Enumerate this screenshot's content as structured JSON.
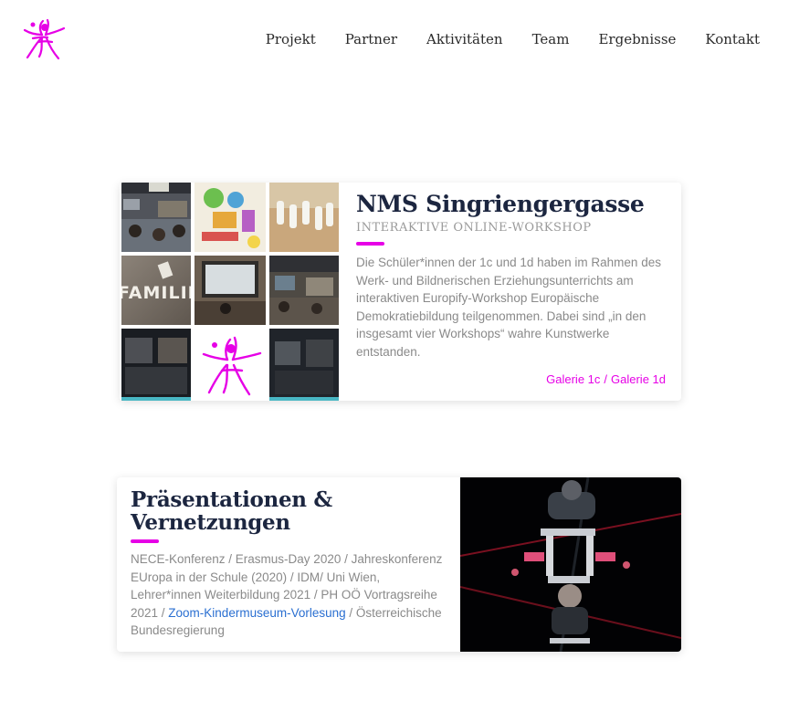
{
  "nav": {
    "items": [
      {
        "label": "Projekt"
      },
      {
        "label": "Partner"
      },
      {
        "label": "Aktivitäten"
      },
      {
        "label": "Team"
      },
      {
        "label": "Ergebnisse"
      },
      {
        "label": "Kontakt"
      }
    ]
  },
  "card1": {
    "title": "NMS Singriengergasse",
    "subtitle": "INTERAKTIVE ONLINE-WORKSHOP",
    "body": "Die Schüler*innen der 1c und 1d haben im Rahmen des Werk- und Bildnerischen Erziehungsunterrichts am interaktiven Europify-Workshop Europäische Demokratiebildung teilgenommen. Dabei sind „in den insgesamt vier Workshops“ wahre Kunstwerke entstanden.",
    "collage_tile_label": "FAMILIE",
    "gallery_links": [
      {
        "label": "Galerie 1c"
      },
      {
        "label": "Galerie 1d"
      }
    ],
    "gallery_separator": "/"
  },
  "card2": {
    "title": "Präsentationen & Vernetzungen",
    "body_before_link": "NECE-Konferenz / Erasmus-Day 2020 / Jahreskonferenz EUropa in der Schule (2020) / IDM/ Uni Wien, Lehrer*innen Weiterbildung 2021 / PH OÖ Vortragsreihe 2021 / ",
    "link": "Zoom-Kindermuseum-Vorlesung",
    "body_after_link": " / Österreichische Bundesregierung"
  },
  "colors": {
    "accent": "#e600e6",
    "title": "#1c2640",
    "body": "#8a8a8a",
    "link": "#2a6fd1"
  },
  "icons": {
    "logo": "dancing-star-logo"
  }
}
